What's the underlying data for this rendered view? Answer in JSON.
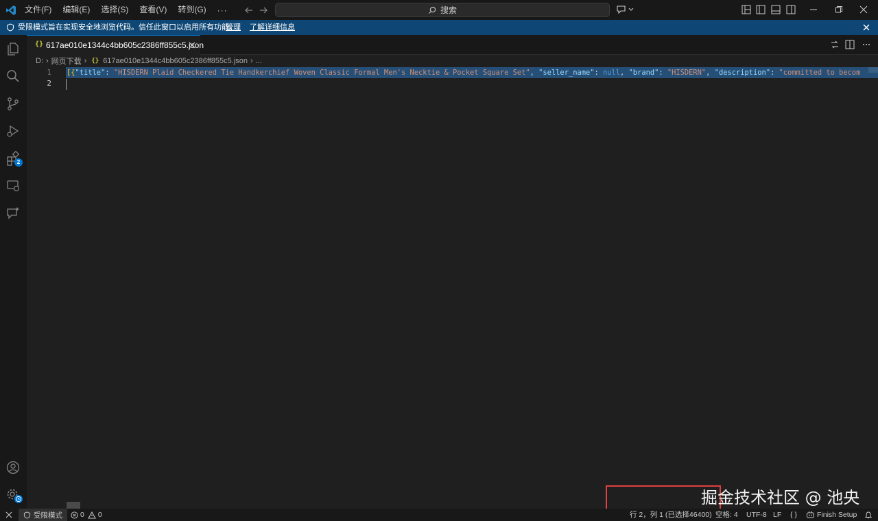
{
  "titlebar": {
    "menus": [
      "文件(F)",
      "编辑(E)",
      "选择(S)",
      "查看(V)",
      "转到(G)"
    ],
    "more": "···",
    "search_placeholder": "搜索"
  },
  "banner": {
    "message": "受限模式旨在实现安全地浏览代码。信任此窗口以启用所有功能。",
    "manage": "管理",
    "learn_more": "了解详细信息"
  },
  "activitybar": {
    "extensions_badge": "2"
  },
  "tab": {
    "filename": "617ae010e1344c4bb605c2386ff855c5.json",
    "icon": "{}"
  },
  "breadcrumb": {
    "drive": "D:",
    "folder": "网页下载",
    "file": "617ae010e1344c4bb605c2386ff855c5.json",
    "tail": "..."
  },
  "editor": {
    "line_numbers": [
      "1",
      "2"
    ],
    "line1_segments": [
      {
        "t": "[{",
        "c": "b"
      },
      {
        "t": "\"title\"",
        "c": "k"
      },
      {
        "t": ": ",
        "c": ""
      },
      {
        "t": "\"HISDERN Plaid Checkered Tie Handkerchief Woven Classic Formal Men's Necktie & Pocket Square Set\"",
        "c": "s"
      },
      {
        "t": ", ",
        "c": ""
      },
      {
        "t": "\"seller_name\"",
        "c": "k"
      },
      {
        "t": ": ",
        "c": ""
      },
      {
        "t": "null",
        "c": "c"
      },
      {
        "t": ", ",
        "c": ""
      },
      {
        "t": "\"brand\"",
        "c": "k"
      },
      {
        "t": ": ",
        "c": ""
      },
      {
        "t": "\"HISDERN\"",
        "c": "s"
      },
      {
        "t": ", ",
        "c": ""
      },
      {
        "t": "\"description\"",
        "c": "k"
      },
      {
        "t": ": ",
        "c": ""
      },
      {
        "t": "\"committed to becom",
        "c": "s"
      }
    ]
  },
  "watermark": "掘金技术社区 @ 池央",
  "statusbar": {
    "restricted_mode": "受限模式",
    "errors": "0",
    "warnings": "0",
    "cursor_position": "行 2，列 1 (已选择46400)",
    "indent": "空格: 4",
    "encoding": "UTF-8",
    "eol": "LF",
    "language": "{ }",
    "finish_setup": "Finish Setup"
  },
  "colors": {
    "accent": "#0078d4",
    "banner": "#0e4775",
    "selection": "#264f78",
    "highlight_box": "#e0403f"
  }
}
